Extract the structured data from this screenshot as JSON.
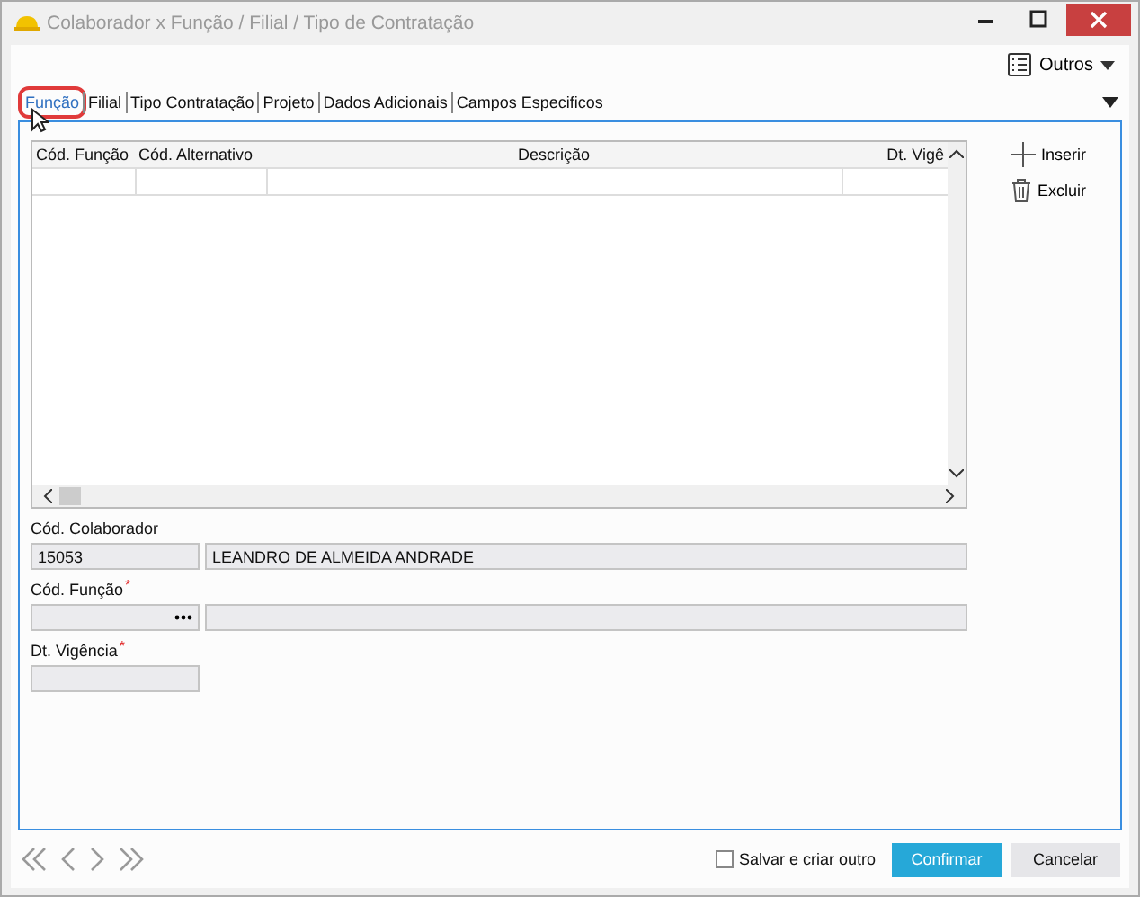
{
  "window": {
    "title": "Colaborador x Função / Filial / Tipo de Contratação"
  },
  "toolbar": {
    "menu_label": "Outros"
  },
  "tabs": [
    {
      "label": "Função",
      "selected": true
    },
    {
      "label": "Filial",
      "selected": false
    },
    {
      "label": "Tipo Contratação",
      "selected": false
    },
    {
      "label": "Projeto",
      "selected": false
    },
    {
      "label": "Dados Adicionais",
      "selected": false
    },
    {
      "label": "Campos Especificos",
      "selected": false
    }
  ],
  "table": {
    "columns": [
      "Cód. Função",
      "Cód. Alternativo",
      "Descrição",
      "Dt. Vigê"
    ]
  },
  "side_actions": [
    {
      "label": "Inserir",
      "kind": "add"
    },
    {
      "label": "Excluir",
      "kind": "delete"
    }
  ],
  "fields": [
    {
      "label": "Cód. Colaborador",
      "kind": "code",
      "value": "15053",
      "lookup": false,
      "description": "LEANDRO DE ALMEIDA ANDRADE"
    },
    {
      "label": "Cód. Função",
      "required_mark": "*",
      "kind": "code",
      "lookup": true
    },
    {
      "label": "Dt. Vigência",
      "required_mark": "*",
      "kind": "date",
      "lookup": false
    }
  ],
  "footer": {
    "save_and_new": {
      "label": "Salvar e criar outro",
      "checked": false
    },
    "buttons": [
      {
        "label": "Confirmar",
        "kind": "primary"
      },
      {
        "label": "Cancelar",
        "kind": "secondary"
      }
    ]
  }
}
